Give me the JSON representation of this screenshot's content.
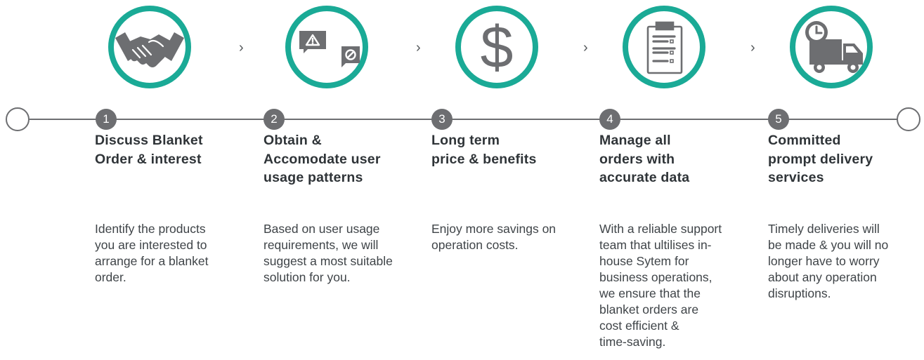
{
  "steps": [
    {
      "number": "1",
      "icon": "handshake-icon",
      "title_lines": [
        "Discuss Blanket",
        "Order & interest"
      ],
      "desc_lines": [
        "Identify the products",
        "you are interested to",
        "arrange for a blanket",
        "order."
      ]
    },
    {
      "number": "2",
      "icon": "chat-warning-icon",
      "title_lines": [
        "Obtain &",
        "Accomodate user",
        "usage patterns"
      ],
      "desc_lines": [
        "Based on user usage",
        "requirements, we will",
        "suggest a most suitable",
        "solution for you."
      ]
    },
    {
      "number": "3",
      "icon": "dollar-icon",
      "title_lines": [
        "Long term",
        "price & benefits"
      ],
      "desc_lines": [
        "Enjoy more savings on",
        "operation costs."
      ]
    },
    {
      "number": "4",
      "icon": "clipboard-icon",
      "title_lines": [
        "Manage all",
        "orders with",
        "accurate data"
      ],
      "desc_lines": [
        "With a reliable support",
        "team that ultilises in-",
        "house Sytem for",
        "business operations,",
        "we ensure that the",
        "blanket orders are",
        "cost efficient &",
        "time-saving."
      ]
    },
    {
      "number": "5",
      "icon": "delivery-truck-icon",
      "title_lines": [
        "Committed",
        "prompt delivery",
        "services"
      ],
      "desc_lines": [
        "Timely deliveries will",
        "be made & you will no",
        "longer have to worry",
        "about any operation",
        "disruptions."
      ]
    }
  ],
  "separator": "›",
  "colors": {
    "accent": "#1aaa96",
    "icon_fill": "#6d6e71",
    "line": "#6d6e71",
    "text": "#3f4448"
  }
}
